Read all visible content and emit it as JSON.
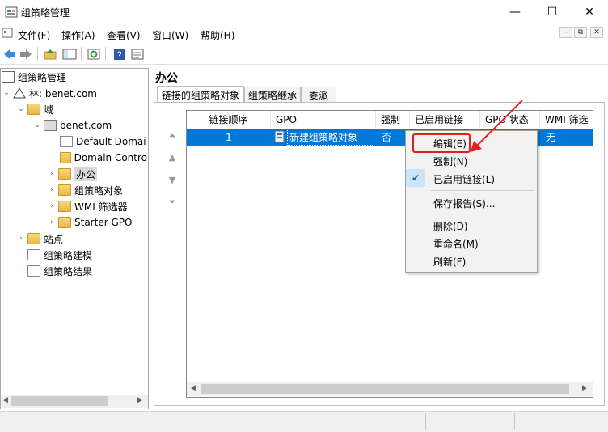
{
  "window": {
    "title": "组策略管理",
    "minimize": "—",
    "maximize": "☐",
    "close": "✕"
  },
  "menu": [
    "文件(F)",
    "操作(A)",
    "查看(V)",
    "窗口(W)",
    "帮助(H)"
  ],
  "mdi": {
    "min": "–",
    "restore": "⧉",
    "close": "✕"
  },
  "tree": {
    "root": "组策略管理",
    "forest": "林: benet.com",
    "domains": "域",
    "domain": "benet.com",
    "items": [
      "Default Domai",
      "Domain Contro",
      "办公",
      "组策略对象",
      "WMI 筛选器",
      "Starter GPO"
    ],
    "sites": "站点",
    "modeling": "组策略建模",
    "results": "组策略结果"
  },
  "right": {
    "title": "办公",
    "tabs": [
      "链接的组策略对象",
      "组策略继承",
      "委派"
    ],
    "columns": [
      "链接顺序",
      "GPO",
      "强制",
      "已启用链接",
      "GPO 状态",
      "WMI 筛选"
    ],
    "row": {
      "order": "1",
      "gpo": "新建组策略对象",
      "enforced": "否",
      "wmi": "无"
    }
  },
  "context_menu": {
    "items": [
      "编辑(E)",
      "强制(N)",
      "已启用链接(L)",
      "保存报告(S)...",
      "删除(D)",
      "重命名(M)",
      "刷新(F)"
    ],
    "checked": "✔"
  },
  "colors": {
    "selection": "#0078d7",
    "annotation": "#e0201c"
  }
}
